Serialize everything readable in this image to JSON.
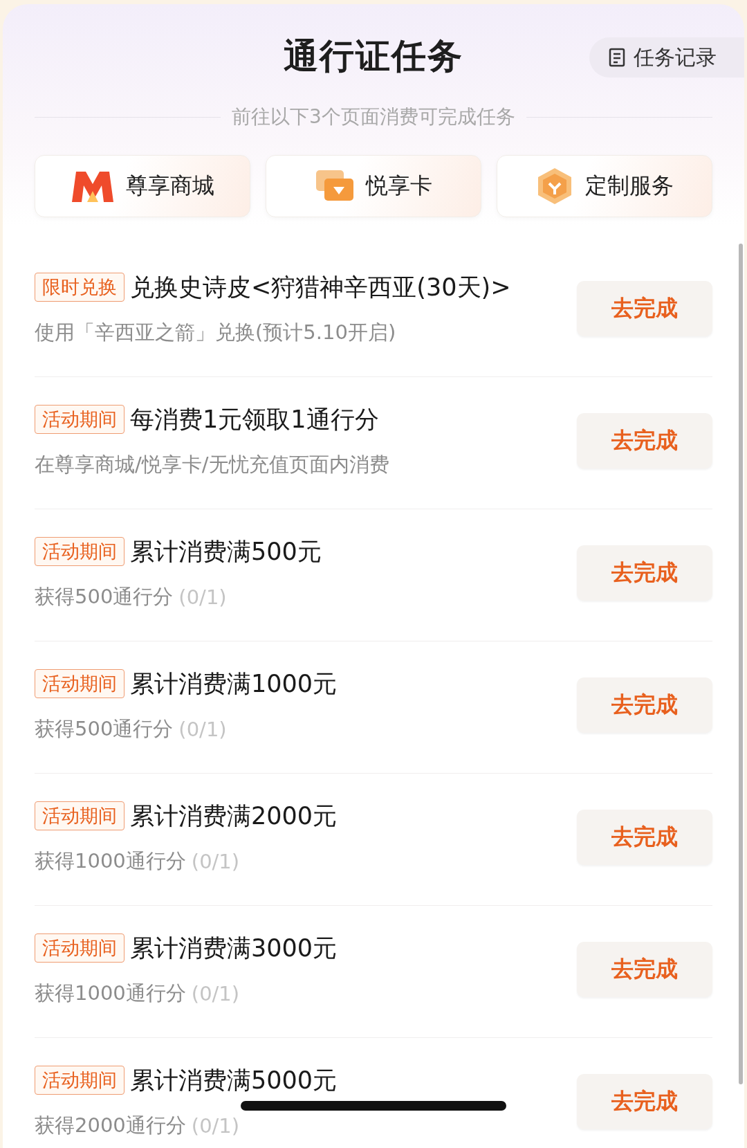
{
  "header": {
    "title": "通行证任务",
    "record_button": "任务记录"
  },
  "subtitle": "前往以下3个页面消费可完成任务",
  "shortcuts": [
    {
      "kind": "mall",
      "label": "尊享商城"
    },
    {
      "kind": "card",
      "label": "悦享卡"
    },
    {
      "kind": "service",
      "label": "定制服务"
    }
  ],
  "tasks": [
    {
      "tag": "限时兑换",
      "title": "兑换史诗皮<狩猎神辛西亚(30天)>",
      "desc": "使用「辛西亚之箭」兑换(预计5.10开启)",
      "button": "去完成"
    },
    {
      "tag": "活动期间",
      "title": "每消费1元领取1通行分",
      "desc": "在尊享商城/悦享卡/无忧充值页面内消费",
      "button": "去完成"
    },
    {
      "tag": "活动期间",
      "title": "累计消费满500元",
      "desc": "获得500通行分",
      "progress": "(0/1)",
      "button": "去完成"
    },
    {
      "tag": "活动期间",
      "title": "累计消费满1000元",
      "desc": "获得500通行分",
      "progress": "(0/1)",
      "button": "去完成"
    },
    {
      "tag": "活动期间",
      "title": "累计消费满2000元",
      "desc": "获得1000通行分",
      "progress": "(0/1)",
      "button": "去完成"
    },
    {
      "tag": "活动期间",
      "title": "累计消费满3000元",
      "desc": "获得1000通行分",
      "progress": "(0/1)",
      "button": "去完成"
    },
    {
      "tag": "活动期间",
      "title": "累计消费满5000元",
      "desc": "获得2000通行分",
      "progress": "(0/1)",
      "button": "去完成"
    }
  ]
}
